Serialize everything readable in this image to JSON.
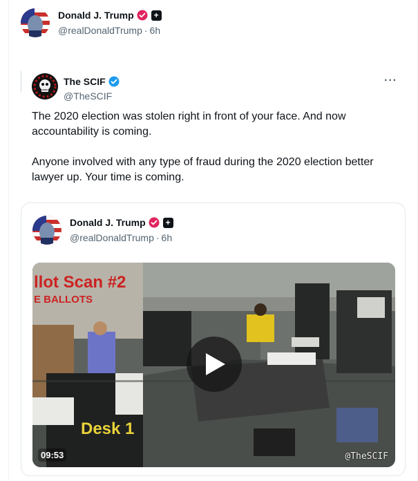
{
  "post": {
    "author_name": "Donald J. Trump",
    "author_handle": "@realDonaldTrump",
    "separator": "·",
    "time": "6h",
    "verified_badge_color": "#e0245e",
    "affiliation_icon": "plus-square-icon"
  },
  "quoted": {
    "author_name": "The SCIF",
    "author_handle": "@TheSCIF",
    "verified_badge_color": "#1d9bf0",
    "more_label": "···",
    "text_paragraphs": [
      "The 2020 election was stolen right in front of your face. And now accountability is coming.",
      "Anyone involved with any type of fraud during the 2020 election better lawyer up. Your time is coming."
    ]
  },
  "embedded": {
    "author_name": "Donald J. Trump",
    "author_handle": "@realDonaldTrump",
    "separator": "·",
    "time": "6h",
    "video": {
      "duration": "09:53",
      "watermark": "@TheSCIF",
      "overlay_title": "llot Scan #2",
      "overlay_subtitle": "E BALLOTS",
      "desk_label": "Desk 1",
      "play_icon": "play-icon"
    }
  }
}
